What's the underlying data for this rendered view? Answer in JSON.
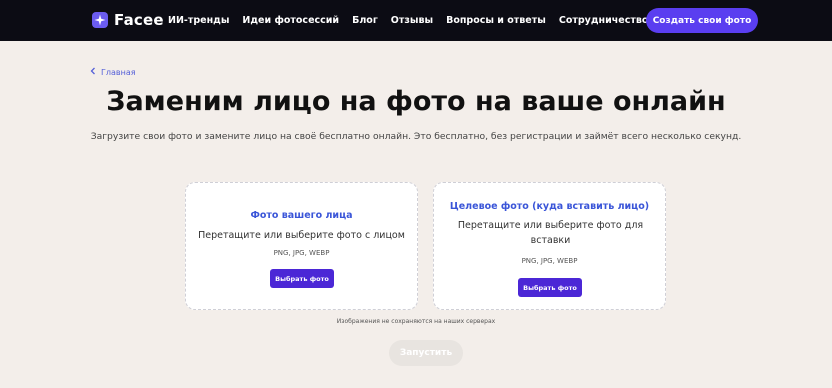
{
  "header": {
    "brand": "Facee",
    "nav": [
      "ИИ-тренды",
      "Идеи фотосессий",
      "Блог",
      "Отзывы",
      "Вопросы и ответы",
      "Сотрудничество"
    ],
    "cta_label": "Создать свои фото"
  },
  "breadcrumb": {
    "label": "Главная",
    "icon": "chevron-left-icon"
  },
  "hero": {
    "title": "Заменим лицо на фото на ваше онлайн",
    "subtitle": "Загрузите свои фото и замените лицо на своё бесплатно онлайн. Это бесплатно, без регистрации и займёт всего несколько секунд."
  },
  "upload": {
    "source": {
      "title": "Фото вашего лица",
      "description": "Перетащите или выберите фото с лицом",
      "formats": "PNG, JPG, WEBP",
      "button_label": "Выбрать фото"
    },
    "target": {
      "title": "Целевое фото (куда вставить лицо)",
      "description": "Перетащите или выберите фото для вставки",
      "formats": "PNG, JPG, WEBP",
      "button_label": "Выбрать фото"
    }
  },
  "privacy_note": "Изображения не сохраняются на наших серверах",
  "run_label": "Запустить",
  "colors": {
    "accent": "#5a3ef0",
    "link": "#3a55d8",
    "background": "#f3eeea",
    "header": "#0c0c14"
  }
}
